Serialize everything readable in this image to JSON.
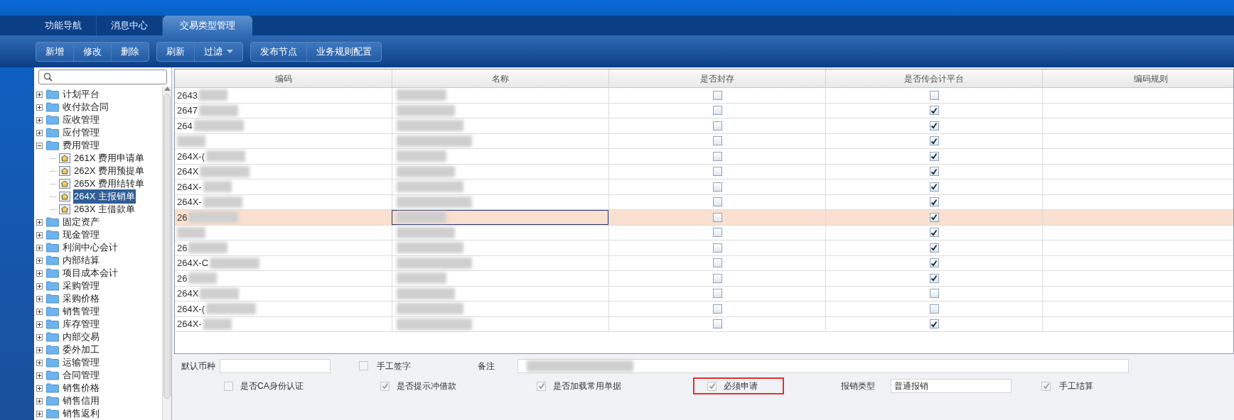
{
  "tabs": [
    {
      "label": "功能导航",
      "selected": false
    },
    {
      "label": "消息中心",
      "selected": false
    },
    {
      "label": "交易类型管理",
      "selected": true
    }
  ],
  "toolbar": [
    [
      {
        "label": "新增"
      },
      {
        "label": "修改"
      },
      {
        "label": "删除"
      }
    ],
    [
      {
        "label": "刷新"
      },
      {
        "label": "过滤",
        "dropdown": true
      }
    ],
    [
      {
        "label": "发布节点"
      },
      {
        "label": "业务规则配置"
      }
    ]
  ],
  "tree": [
    {
      "label": "计划平台",
      "expanded": false
    },
    {
      "label": "收付款合同",
      "expanded": false
    },
    {
      "label": "应收管理",
      "expanded": false
    },
    {
      "label": "应付管理",
      "expanded": false
    },
    {
      "label": "费用管理",
      "expanded": true,
      "children": [
        {
          "label": "261X 费用申请单",
          "selected": false
        },
        {
          "label": "262X 费用预提单",
          "selected": false
        },
        {
          "label": "265X 费用结转单",
          "selected": false
        },
        {
          "label": "264X 主报销单",
          "selected": true
        },
        {
          "label": "263X 主借款单",
          "selected": false
        }
      ]
    },
    {
      "label": "固定资产",
      "expanded": false
    },
    {
      "label": "现金管理",
      "expanded": false
    },
    {
      "label": "利润中心会计",
      "expanded": false
    },
    {
      "label": "内部结算",
      "expanded": false
    },
    {
      "label": "项目成本会计",
      "expanded": false
    },
    {
      "label": "采购管理",
      "expanded": false
    },
    {
      "label": "采购价格",
      "expanded": false
    },
    {
      "label": "销售管理",
      "expanded": false
    },
    {
      "label": "库存管理",
      "expanded": false
    },
    {
      "label": "内部交易",
      "expanded": false
    },
    {
      "label": "委外加工",
      "expanded": false
    },
    {
      "label": "运输管理",
      "expanded": false
    },
    {
      "label": "合同管理",
      "expanded": false
    },
    {
      "label": "销售价格",
      "expanded": false
    },
    {
      "label": "销售信用",
      "expanded": false
    },
    {
      "label": "销售返利",
      "expanded": false
    }
  ],
  "table": {
    "columns": [
      "编码",
      "名称",
      "是否封存",
      "是否传会计平台",
      "编码规则"
    ],
    "rows": [
      {
        "code": "2643",
        "archived": false,
        "to_accounting": false,
        "selected": false
      },
      {
        "code": "2647",
        "archived": false,
        "to_accounting": true,
        "selected": false
      },
      {
        "code": "264",
        "archived": false,
        "to_accounting": true,
        "selected": false
      },
      {
        "archived": false,
        "to_accounting": true,
        "selected": false
      },
      {
        "code": "264X-(",
        "archived": false,
        "to_accounting": true,
        "selected": false
      },
      {
        "code": "264X",
        "archived": false,
        "to_accounting": true,
        "selected": false
      },
      {
        "code": "264X-",
        "archived": false,
        "to_accounting": true,
        "selected": false
      },
      {
        "code": "264X-",
        "archived": false,
        "to_accounting": true,
        "selected": false
      },
      {
        "code": "26",
        "archived": false,
        "to_accounting": true,
        "selected": true
      },
      {
        "archived": false,
        "to_accounting": true,
        "selected": false
      },
      {
        "code": "26",
        "archived": false,
        "to_accounting": true,
        "selected": false
      },
      {
        "code": "264X-C",
        "archived": false,
        "to_accounting": true,
        "selected": false
      },
      {
        "code": "26",
        "archived": false,
        "to_accounting": true,
        "selected": false
      },
      {
        "code": "264X",
        "archived": false,
        "to_accounting": false,
        "selected": false
      },
      {
        "code": "264X-(",
        "archived": false,
        "to_accounting": false,
        "selected": false
      },
      {
        "code": "264X-",
        "archived": false,
        "to_accounting": true,
        "selected": false
      }
    ]
  },
  "form": {
    "currency": {
      "label": "默认币种"
    },
    "manual_sign": {
      "label": "手工签字",
      "checked": false
    },
    "remark": {
      "label": "备注"
    },
    "options": [
      {
        "label": "是否CA身份认证",
        "checked": false,
        "highlighted": false
      },
      {
        "label": "是否提示冲借款",
        "checked": true,
        "highlighted": false
      },
      {
        "label": "是否加载常用单据",
        "checked": true,
        "highlighted": false
      },
      {
        "label": "必须申请",
        "checked": true,
        "highlighted": true
      }
    ],
    "expense_type": {
      "label": "报销类型",
      "value": "普通报销"
    },
    "manual_settle": {
      "label": "手工结算",
      "checked": true
    }
  }
}
